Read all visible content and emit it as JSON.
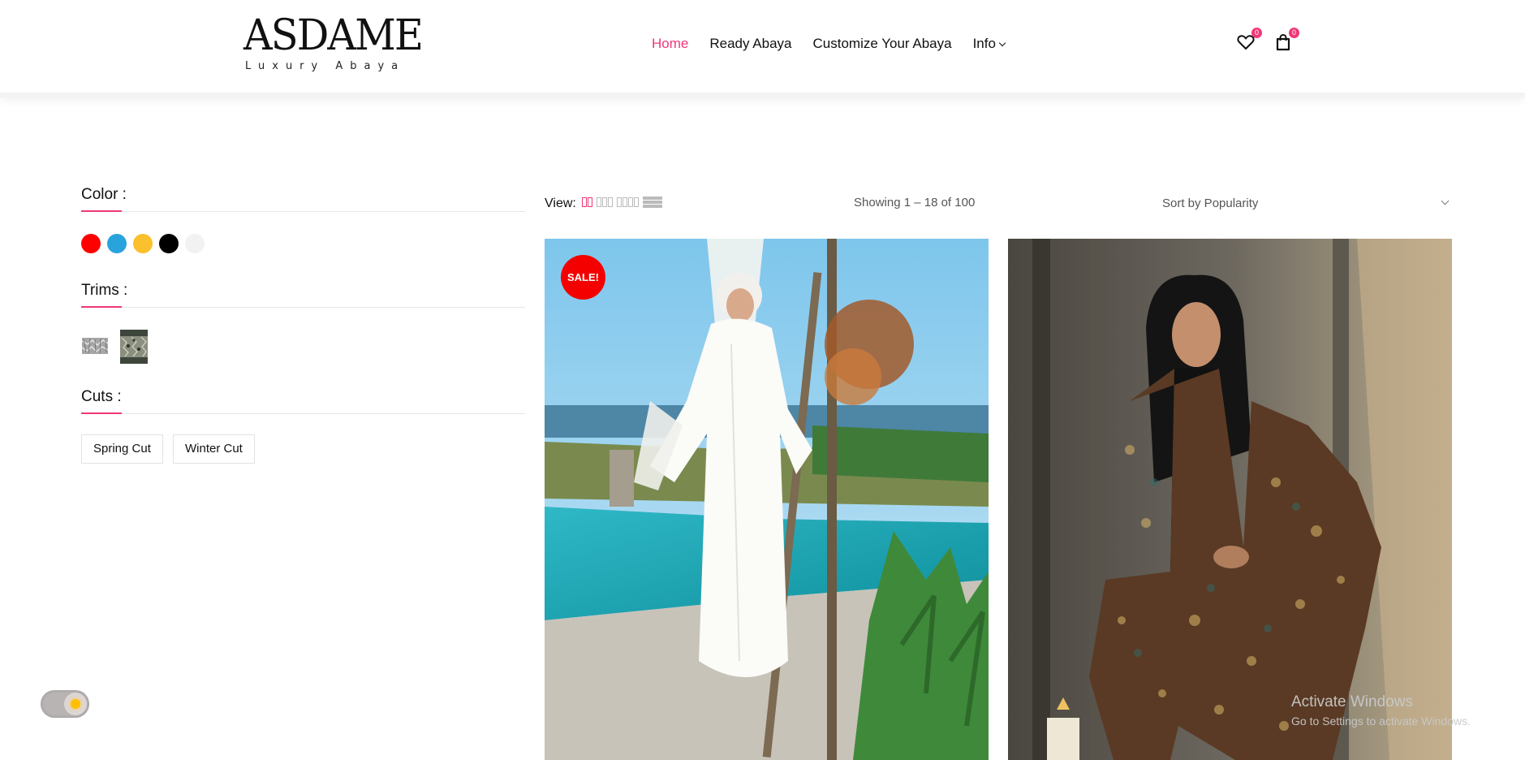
{
  "header": {
    "logo": {
      "main": "ASDAME",
      "sub": "Luxury Abaya"
    },
    "nav": [
      {
        "label": "Home",
        "active": true
      },
      {
        "label": "Ready Abaya"
      },
      {
        "label": "Customize Your Abaya"
      },
      {
        "label": "Info",
        "dropdown": true
      }
    ],
    "wishlist_count": "0",
    "cart_count": "0",
    "accent_color": "#ef3779"
  },
  "filters": {
    "color_title": "Color :",
    "colors": [
      "#ff0000",
      "#29a3db",
      "#fbc02d",
      "#000000",
      "#f2f2f2"
    ],
    "trims_title": "Trims :",
    "cuts_title": "Cuts :",
    "cuts": [
      "Spring Cut",
      "Winter Cut"
    ]
  },
  "toolbar": {
    "view_label": "View:",
    "showing": "Showing 1 – 18 of 100",
    "sort": "Sort by Popularity"
  },
  "products": [
    {
      "badge": "SALE!",
      "image": "white abaya by pool"
    },
    {
      "badge": "",
      "image": "embellished dark abaya"
    }
  ],
  "watermark": {
    "title": "Activate Windows",
    "subtitle": "Go to Settings to activate Windows."
  }
}
